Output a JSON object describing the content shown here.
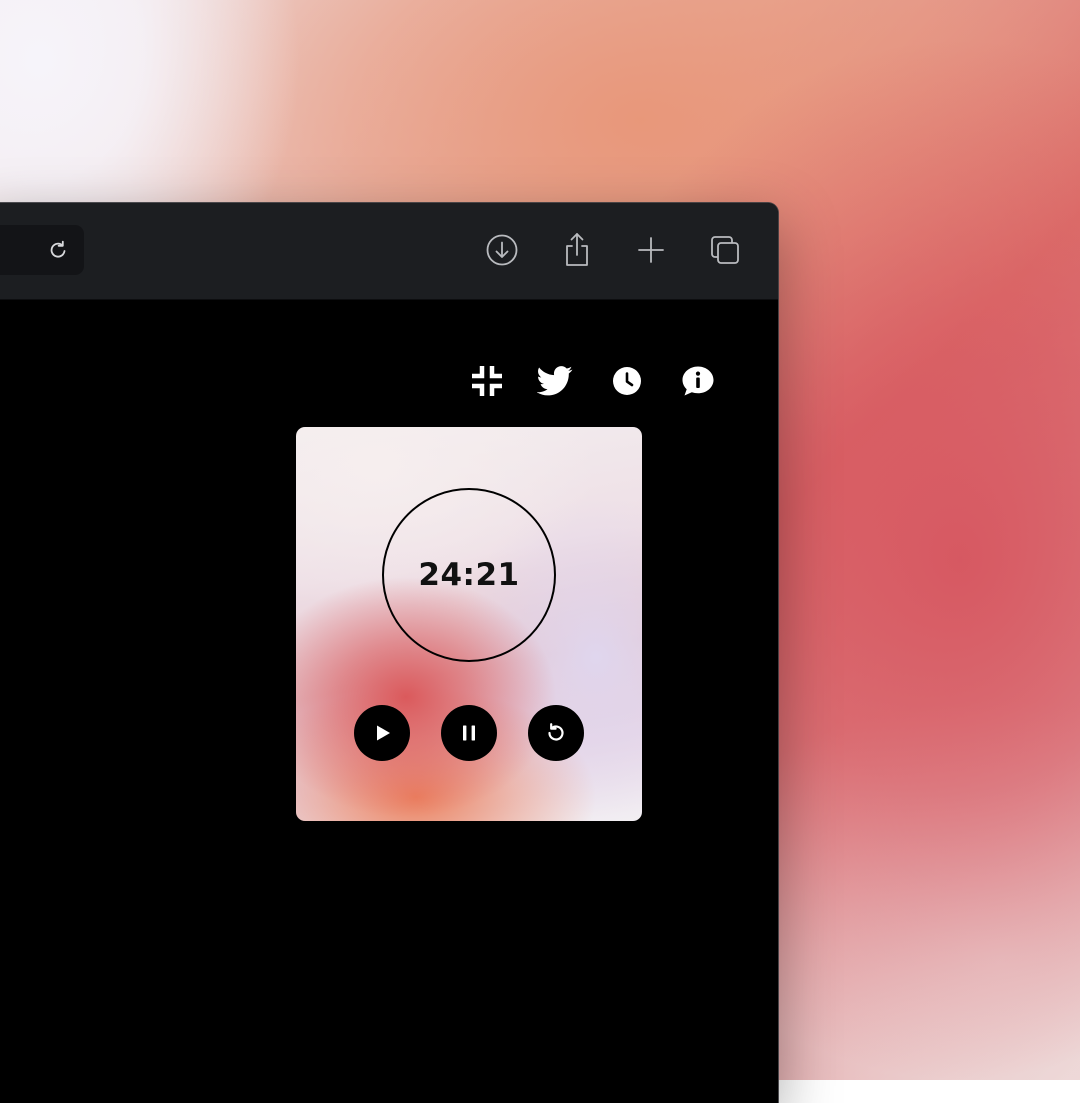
{
  "browser": {
    "toolbar": {
      "icons": [
        "reload-icon",
        "download-icon",
        "share-icon",
        "new-tab-icon",
        "tabs-overview-icon"
      ]
    }
  },
  "app": {
    "header_icons": [
      "exit-fullscreen-icon",
      "twitter-icon",
      "history-clock-icon",
      "info-chat-icon"
    ],
    "timer": {
      "time": "24:21",
      "controls": [
        "play-icon",
        "pause-icon",
        "reset-icon"
      ]
    }
  },
  "colors": {
    "browser_toolbar": "#1c1e21",
    "page_background": "#000000",
    "timer_ring": "#000000",
    "control_button": "#000000"
  }
}
